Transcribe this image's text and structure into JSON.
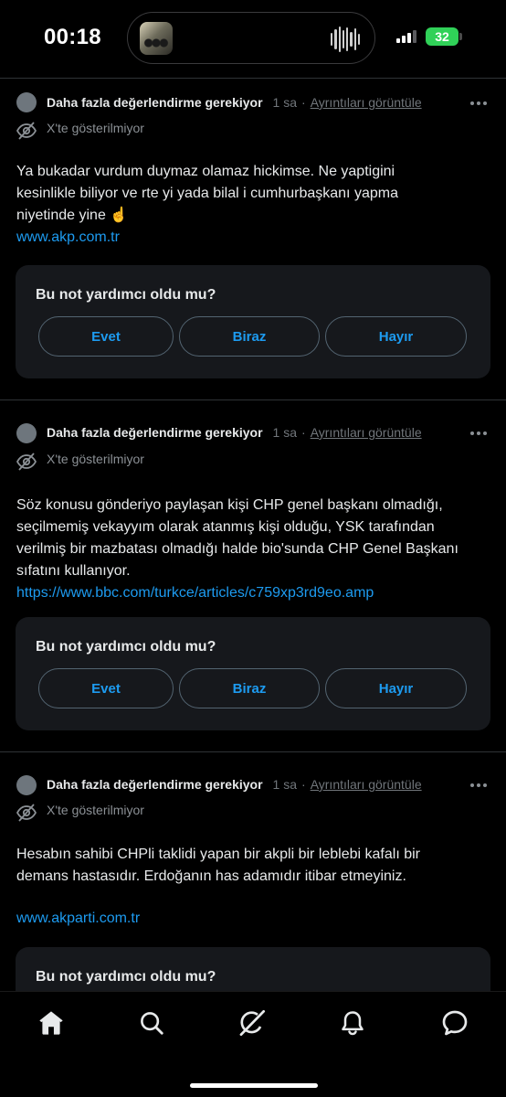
{
  "status_bar": {
    "time": "00:18",
    "battery": "32"
  },
  "rating_prompt": {
    "title": "Bu not yardımcı oldu mu?",
    "options": [
      "Evet",
      "Biraz",
      "Hayır"
    ]
  },
  "notes": [
    {
      "status": "Daha fazla değerlendirme gerekiyor",
      "time": "1 sa",
      "separator": "·",
      "details": "Ayrıntıları görüntüle",
      "visibility": "X'te gösterilmiyor",
      "body_lines": [
        "Ya bukadar vurdum duymaz olamaz hickimse. Ne yaptigini",
        "kesinlikle biliyor ve rte yi yada bilal i cumhurbaşkanı yapma",
        "niyetinde yine ☝️"
      ],
      "link": "www.akp.com.tr"
    },
    {
      "status": "Daha fazla değerlendirme gerekiyor",
      "time": "1 sa",
      "separator": "·",
      "details": "Ayrıntıları görüntüle",
      "visibility": "X'te gösterilmiyor",
      "body_lines": [
        "Söz konusu gönderiyo paylaşan kişi CHP genel başkanı olmadığı,",
        "seçilmemiş vekayyım olarak atanmış kişi olduğu, YSK tarafından",
        "verilmiş bir mazbatası olmadığı halde bio'sunda CHP Genel Başkanı",
        "sıfatını kullanıyor."
      ],
      "link": "https://www.bbc.com/turkce/articles/c759xp3rd9eo.amp"
    },
    {
      "status": "Daha fazla değerlendirme gerekiyor",
      "time": "1 sa",
      "separator": "·",
      "details": "Ayrıntıları görüntüle",
      "visibility": "X'te gösterilmiyor",
      "body_lines": [
        "Hesabın sahibi CHPli taklidi yapan bir akpli bir leblebi kafalı bir",
        "demans hastasıdır. Erdoğanın has adamıdır itibar etmeyiniz."
      ],
      "link": "www.akparti.com.tr"
    }
  ],
  "tab_bar": {
    "tabs": [
      "home-icon",
      "search-icon",
      "grok-icon",
      "bell-icon",
      "messages-icon"
    ],
    "active": "home-icon"
  },
  "colors": {
    "background": "#000000",
    "card": "#16181c",
    "link": "#1d9bf0",
    "muted": "#71767b",
    "battery": "#30d158"
  }
}
